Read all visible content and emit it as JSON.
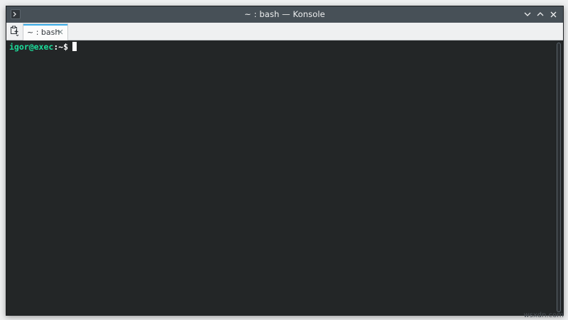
{
  "window": {
    "title": "~ : bash — Konsole"
  },
  "tabs": [
    {
      "label": "~ : bash",
      "active": true
    }
  ],
  "terminal": {
    "prompt_user_host": "igor@exec",
    "prompt_path": ":~$"
  },
  "watermark": "wsxdn.com",
  "icons": {
    "app": "konsole-app-icon",
    "new_tab": "new-tab-icon",
    "tab_close": "close-icon",
    "minimize": "chevron-down-icon",
    "maximize": "chevron-up-icon",
    "close": "close-icon"
  },
  "colors": {
    "titlebar": "#475057",
    "terminal_bg": "#232627",
    "prompt_user": "#1cdc9a",
    "tab_accent": "#3daee9"
  }
}
